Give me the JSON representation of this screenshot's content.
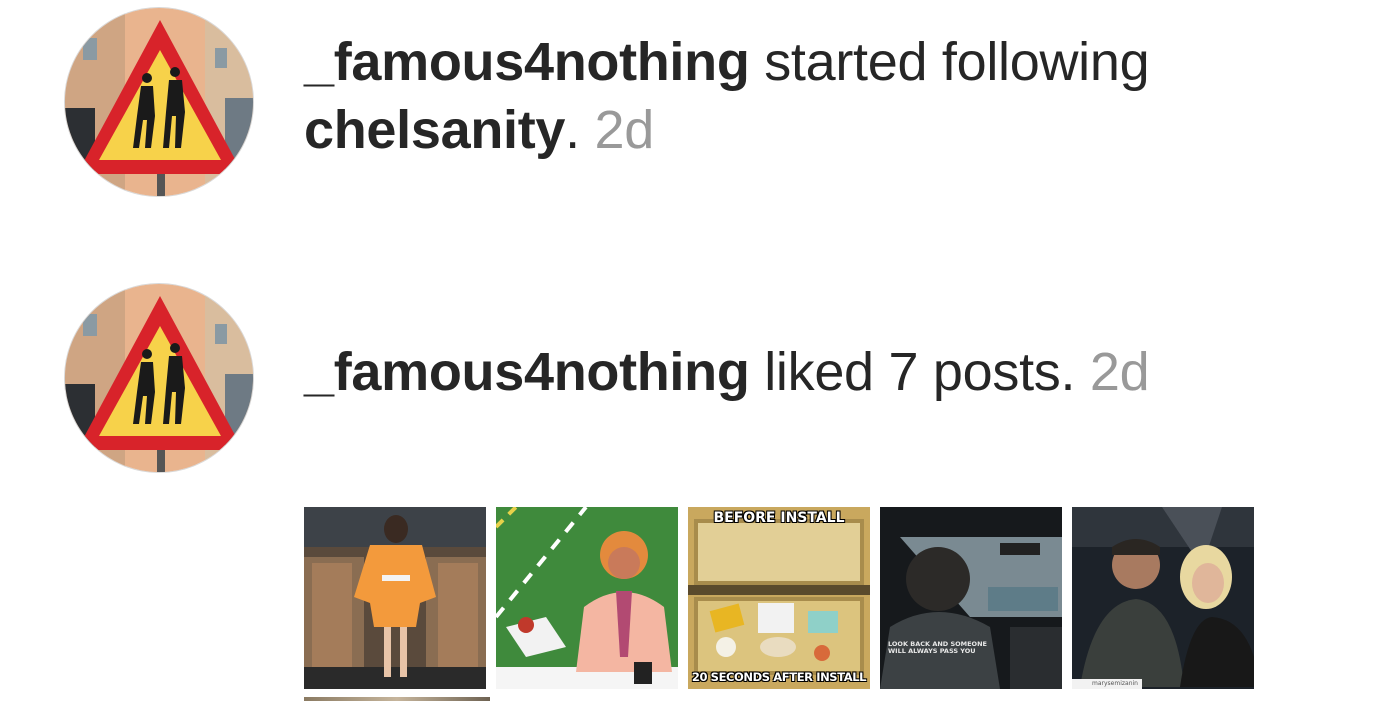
{
  "notifications": [
    {
      "username": "_famous4nothing",
      "action": "started following",
      "target": "chelsanity",
      "punct": ".",
      "time": "2d",
      "avatar_icon": "pedestrian-warning-sign-icon"
    },
    {
      "username": "_famous4nothing",
      "action": "liked 7 posts.",
      "time": "2d",
      "avatar_icon": "pedestrian-warning-sign-icon"
    }
  ],
  "thumbnails": [
    {
      "name": "post-thumbnail-orange-outfit",
      "caption_top": "",
      "caption_bottom": ""
    },
    {
      "name": "post-thumbnail-football-announcer",
      "caption_top": "",
      "caption_bottom": ""
    },
    {
      "name": "post-thumbnail-before-after-install",
      "caption_top": "BEFORE INSTALL",
      "caption_bottom": "20 SECONDS AFTER INSTALL"
    },
    {
      "name": "post-thumbnail-car-driver",
      "caption_top": "",
      "caption_bottom": "LOOK BACK AND SOMEONE WILL ALWAYS PASS YOU"
    },
    {
      "name": "post-thumbnail-couple-selfie",
      "caption_top": "",
      "caption_bottom": "marysemizanin"
    }
  ],
  "colors": {
    "text": "#262626",
    "muted": "#999999",
    "sign_red": "#d8232a",
    "sign_yellow": "#f7d24a"
  }
}
